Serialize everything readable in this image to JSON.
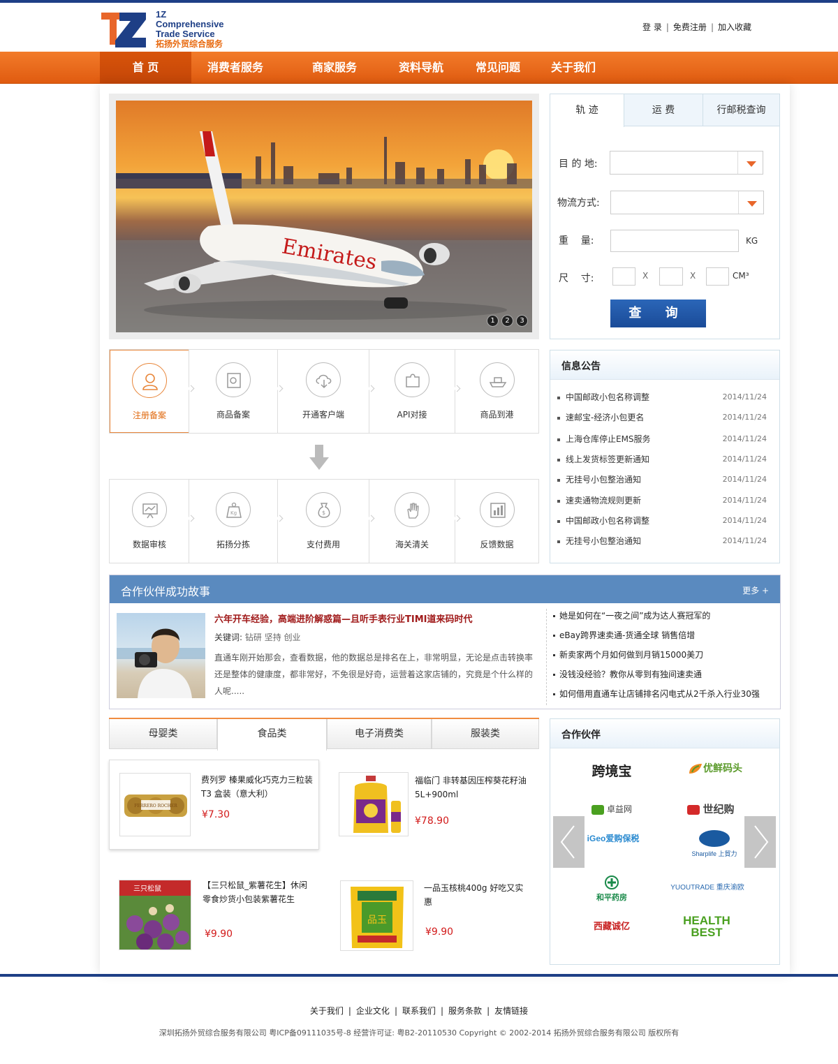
{
  "logo": {
    "line1": "1Z",
    "line2": "Comprehensive",
    "line3": "Trade Service",
    "line4": "拓扬外贸综合服务"
  },
  "toplinks": {
    "login": "登 录",
    "register": "免费注册",
    "favorite": "加入收藏"
  },
  "nav": {
    "items": [
      "首 页",
      "消费者服务",
      "商家服务",
      "资料导航",
      "常见问题",
      "关于我们"
    ]
  },
  "banner": {
    "dots": [
      "1",
      "2",
      "3"
    ],
    "plane_text": "Emirates"
  },
  "query": {
    "tabs": [
      "轨 迹",
      "运 费",
      "行邮税查询"
    ],
    "dest_label": "目 的 地:",
    "method_label": "物流方式:",
    "weight_label": "重    量:",
    "weight_unit": "KG",
    "size_label": "尺    寸:",
    "x1": "X",
    "x2": "X",
    "size_unit": "CM³",
    "button": "查 询"
  },
  "steps_top": [
    "注册备案",
    "商品备案",
    "开通客户端",
    "API对接",
    "商品到港"
  ],
  "steps_bottom": [
    "数据审核",
    "拓扬分拣",
    "支付费用",
    "海关清关",
    "反馈数据"
  ],
  "notice": {
    "title": "信息公告",
    "items": [
      {
        "text": "中国邮政小包名称调整",
        "date": "2014/11/24"
      },
      {
        "text": "速邮宝-经济小包更名",
        "date": "2014/11/24"
      },
      {
        "text": "上海仓库停止EMS服务",
        "date": "2014/11/24"
      },
      {
        "text": "线上发货标签更新通知",
        "date": "2014/11/24"
      },
      {
        "text": "无挂号小包整治通知",
        "date": "2014/11/24"
      },
      {
        "text": "速卖通物流规则更新",
        "date": "2014/11/24"
      },
      {
        "text": "中国邮政小包名称调整",
        "date": "2014/11/24"
      },
      {
        "text": "无挂号小包整治通知",
        "date": "2014/11/24"
      }
    ]
  },
  "story": {
    "title": "合作伙伴成功故事",
    "more": "更多 +",
    "headline": "六年开车经验，高端进阶解惑篇—且听手表行业TIMI道来码时代",
    "keywords_label": "关键词:",
    "keywords": "钻研  坚持  创业",
    "desc": "直通车刚开始那会，查看数据，他的数据总是排名在上，非常明显，无论是点击转换率还是整体的健康度，都非常好，不免很是好奇，运营着这家店铺的，究竟是个什么样的人呢.....",
    "list": [
      "她是如何在“一夜之间”成为达人赛冠军的",
      "eBay跨界速卖通-货通全球 销售倍增",
      "新卖家两个月如何做到月销15000美刀",
      "没钱没经验？教你从零到有独间速卖通",
      "如何借用直通车让店铺排名闪电式从2千杀入行业30强"
    ]
  },
  "categories": {
    "tabs": [
      "母婴类",
      "食品类",
      "电子消费类",
      "服装类"
    ],
    "products": [
      {
        "name": "费列罗 榛果威化巧克力三粒装T3 盒装（意大利）",
        "price": "¥7.30"
      },
      {
        "name": "福临门 非转基因压榨葵花籽油5L+900ml",
        "price": "¥78.90"
      },
      {
        "name": "【三只松鼠_紫薯花生】休闲零食炒货小包装紫薯花生",
        "price": "¥9.90"
      },
      {
        "name": "一品玉核桃400g 好吃又实惠",
        "price": "¥9.90"
      }
    ],
    "ferrero_text": "FERRERO ROCHER",
    "squirrel_text": "三只松鼠",
    "walnut_text": "品玉"
  },
  "partners": {
    "title": "合作伙伴",
    "logos": [
      {
        "name": "跨境宝",
        "color": "#222222"
      },
      {
        "name": "优鲜码头",
        "color": "#5a9a2a"
      },
      {
        "name": "卓益网",
        "color": "#444444"
      },
      {
        "name": "世纪购",
        "color": "#444444"
      },
      {
        "name": "iGeo爱购保税",
        "color": "#2a8ad0"
      },
      {
        "name": "Sharplife 上貿力",
        "color": "#1a5aa0"
      },
      {
        "name": "和平药房",
        "color": "#1a8a4a"
      },
      {
        "name": "YUOUTRADE 重庆渝欧",
        "color": "#2a6ab0"
      },
      {
        "name": "西藏诚亿",
        "color": "#c82020"
      },
      {
        "name": "HEALTH BEST",
        "color": "#4aa020"
      }
    ]
  },
  "footer": {
    "links": [
      "关于我们",
      "企业文化",
      "联系我们",
      "服务条款",
      "友情链接"
    ],
    "copyright": "深圳拓扬外贸综合服务有限公司 粤ICP备09111035号-8 经营许可证: 粤B2-20110530 Copyright © 2002-2014 拓扬外贸综合服务有限公司 版权所有"
  },
  "colors": {
    "brand_blue": "#1e3f86",
    "brand_orange": "#e8662a",
    "price_red": "#d21a1a"
  }
}
